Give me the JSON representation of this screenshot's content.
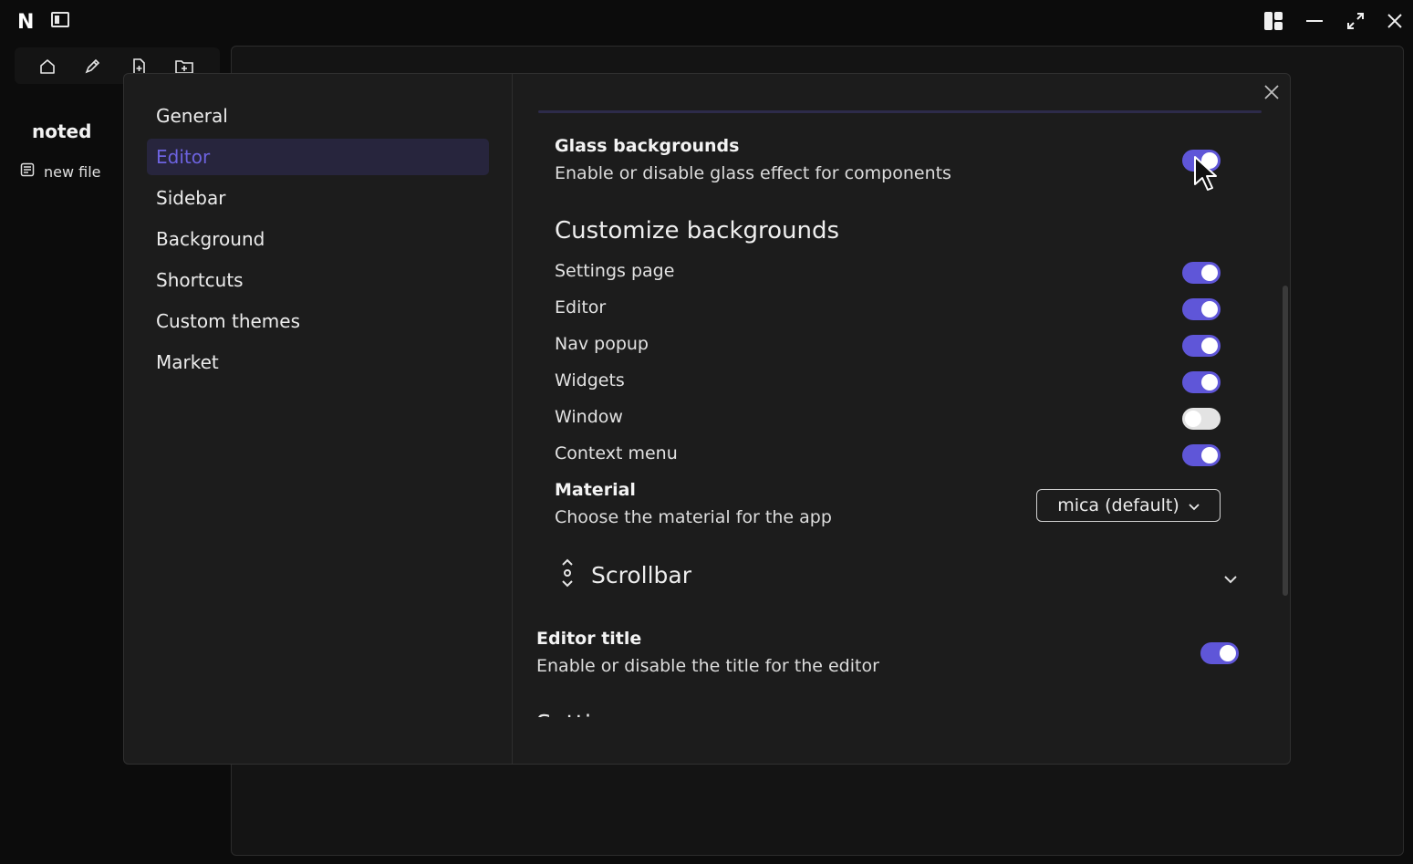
{
  "titlebar": {
    "logo": "N",
    "buttons": [
      "layout-icon",
      "minimize-icon",
      "maximize-icon",
      "close-icon"
    ]
  },
  "app_sidebar": {
    "app_name": "noted",
    "toolbar_icons": [
      "home-icon",
      "edit-icon",
      "new-file-icon",
      "new-folder-icon"
    ],
    "files": [
      {
        "label": "new file",
        "icon": "file-text-icon"
      }
    ]
  },
  "settings_nav": {
    "items": [
      {
        "label": "General"
      },
      {
        "label": "Editor",
        "active": true
      },
      {
        "label": "Sidebar"
      },
      {
        "label": "Background"
      },
      {
        "label": "Shortcuts"
      },
      {
        "label": "Custom themes"
      },
      {
        "label": "Market"
      }
    ]
  },
  "settings": {
    "glass": {
      "label": "Glass backgrounds",
      "description": "Enable or disable glass effect for components",
      "enabled": true
    },
    "customize_title": "Customize backgrounds",
    "customize_rows": [
      {
        "label": "Settings page",
        "enabled": true
      },
      {
        "label": "Editor",
        "enabled": true
      },
      {
        "label": "Nav popup",
        "enabled": true
      },
      {
        "label": "Widgets",
        "enabled": true
      },
      {
        "label": "Window",
        "enabled": false
      },
      {
        "label": "Context menu",
        "enabled": true
      }
    ],
    "material": {
      "label": "Material",
      "description": "Choose the material for the app",
      "value": "mica (default)"
    },
    "scrollbar_section": {
      "title": "Scrollbar",
      "icon": "scroll-arrows-icon"
    },
    "editor_title": {
      "label": "Editor title",
      "description": "Enable or disable the title for the editor",
      "enabled": true
    },
    "cut_off_heading": "Settings"
  },
  "colors": {
    "accent": "#5f56d8",
    "accent_text": "#6d63e0",
    "active_nav_bg": "#27253d",
    "modal_bg": "#1c1c1c",
    "app_bg": "#0c0c0c"
  }
}
